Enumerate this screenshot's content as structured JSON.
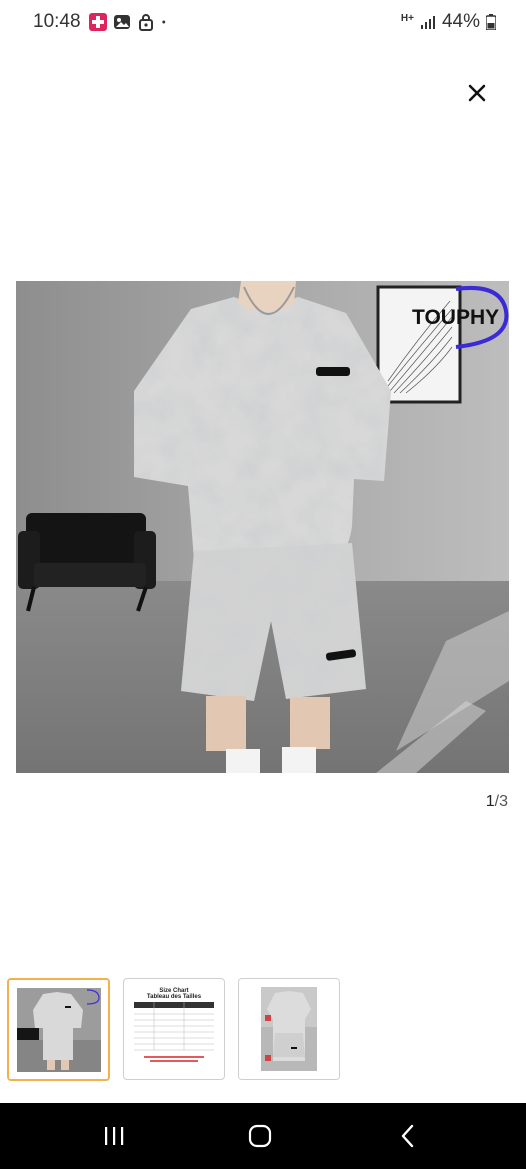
{
  "status": {
    "time": "10:48",
    "network": "H+",
    "battery": "44%"
  },
  "viewer": {
    "brand_logo": "TOUPHY",
    "page_current": "1",
    "page_total": "/3"
  },
  "thumbnails": [
    {
      "name": "product-photo",
      "selected": true
    },
    {
      "name": "size-chart",
      "title": "Size Chart",
      "subtitle": "Tableau des Tailles"
    },
    {
      "name": "model-photo"
    }
  ],
  "icons": {
    "close": "close-icon",
    "nav_recents": "recents-icon",
    "nav_home": "home-icon",
    "nav_back": "back-icon"
  }
}
